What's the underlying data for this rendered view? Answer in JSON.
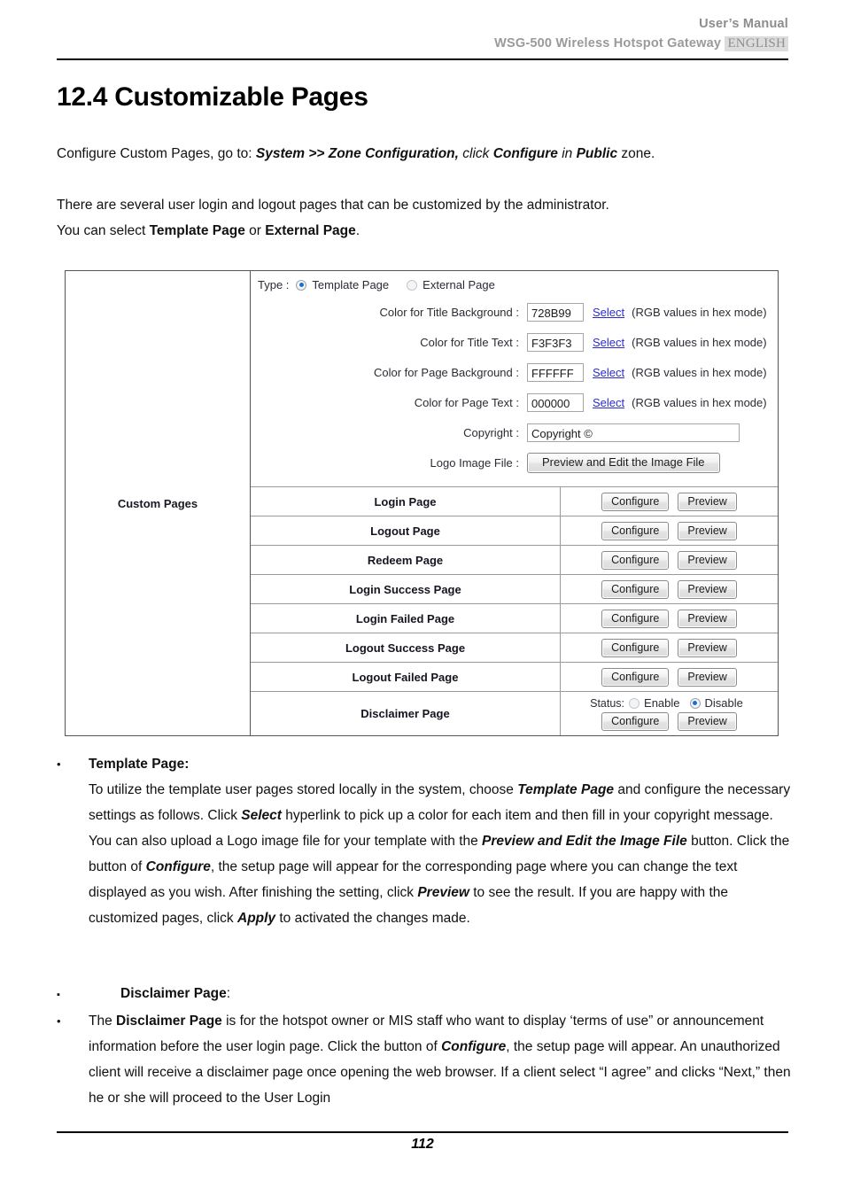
{
  "header": {
    "line1": "User’s Manual",
    "line2_prefix": "WSG-500 Wireless Hotspot Gateway",
    "language_badge": "ENGLISH"
  },
  "section": {
    "title": "12.4 Customizable Pages"
  },
  "intro": {
    "line1_a": "Configure Custom Pages, go to: ",
    "line1_b": "System >> Zone Configuration,",
    "line1_c": " click ",
    "line1_d": "Configure",
    "line1_e": " in ",
    "line1_f": "Public",
    "line1_g": " zone.",
    "line2_a": "There are several user login and logout pages that can be customized by the administrator.",
    "line3_a": "You can select ",
    "line3_b": "Template Page",
    "line3_c": " or ",
    "line3_d": "External Page",
    "line3_e": "."
  },
  "screenshot": {
    "left_label": "Custom Pages",
    "type": {
      "label": "Type :",
      "option_template": "Template Page",
      "option_external": "External Page",
      "selected": "Template Page"
    },
    "fields": [
      {
        "label": "Color for Title Background :",
        "value": "728B99",
        "select_label": "Select",
        "hint": "(RGB values in hex mode)"
      },
      {
        "label": "Color for Title Text :",
        "value": "F3F3F3",
        "select_label": "Select",
        "hint": "(RGB values in hex mode)"
      },
      {
        "label": "Color for Page Background :",
        "value": "FFFFFF",
        "select_label": "Select",
        "hint": "(RGB values in hex mode)"
      },
      {
        "label": "Color for Page Text :",
        "value": "000000",
        "select_label": "Select",
        "hint": "(RGB values in hex mode)"
      }
    ],
    "copyright": {
      "label": "Copyright :",
      "value": "Copyright ©"
    },
    "logo": {
      "label": "Logo Image File :",
      "button_label": "Preview and Edit the Image File"
    },
    "buttons": {
      "configure": "Configure",
      "preview": "Preview"
    },
    "pages": [
      {
        "name": "Login Page"
      },
      {
        "name": "Logout Page"
      },
      {
        "name": "Redeem Page"
      },
      {
        "name": "Login Success Page"
      },
      {
        "name": "Login Failed Page"
      },
      {
        "name": "Logout Success Page"
      },
      {
        "name": "Logout Failed Page"
      }
    ],
    "disclaimer_row": {
      "name": "Disclaimer Page",
      "status_label": "Status:",
      "enable_label": "Enable",
      "disable_label": "Disable",
      "selected_status": "Disable"
    }
  },
  "body": {
    "b1_bullet": "•",
    "b1_head": "Template Page:",
    "b1_p1a": "To utilize the template user pages stored locally in the system, choose ",
    "b1_p1b": "Template Page",
    "b1_p1c": " and configure the necessary settings as follows. Click ",
    "b1_p1d": "Select",
    "b1_p1e": " hyperlink to pick up a color for each item and then fill in your copyright message. You can also upload a Logo image file for your template with the ",
    "b1_p1f": "Preview and Edit the Image File",
    "b1_p1g": " button. Click the button of ",
    "b1_p1h": "Configure",
    "b1_p1i": ", the setup page will appear for the corresponding page where you can change the text displayed as you wish. After finishing the setting, click ",
    "b1_p1j": "Preview",
    "b1_p1k": " to see the result. If you are happy with the customized pages, click ",
    "b1_p1l": "Apply",
    "b1_p1m": " to activated the changes made.",
    "b2_bullet": "▪",
    "b2_head_a": "Disclaimer Page",
    "b2_head_b": ":",
    "b3_bullet": "•",
    "b3_p1a": "The ",
    "b3_p1b": "Disclaimer Page",
    "b3_p1c": " is for the hotspot owner or MIS staff who want to display ‘terms of use” or announcement information before the user login page. Click the button of ",
    "b3_p1d": "Configure",
    "b3_p1e": ", the setup page will appear. An unauthorized client will receive a disclaimer page once opening the web browser. If a client select “I agree” and clicks “Next,” then he or she will proceed to the User Login"
  },
  "footer": {
    "page_number": "112"
  }
}
